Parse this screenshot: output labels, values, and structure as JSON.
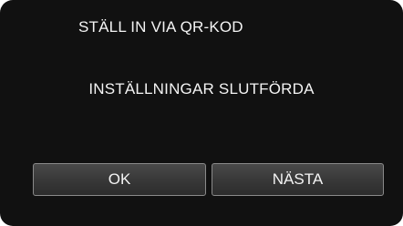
{
  "screen": {
    "title": "STÄLL IN VIA QR-KOD",
    "message": "INSTÄLLNINGAR SLUTFÖRDA"
  },
  "buttons": {
    "ok_label": "OK",
    "next_label": "NÄSTA"
  }
}
